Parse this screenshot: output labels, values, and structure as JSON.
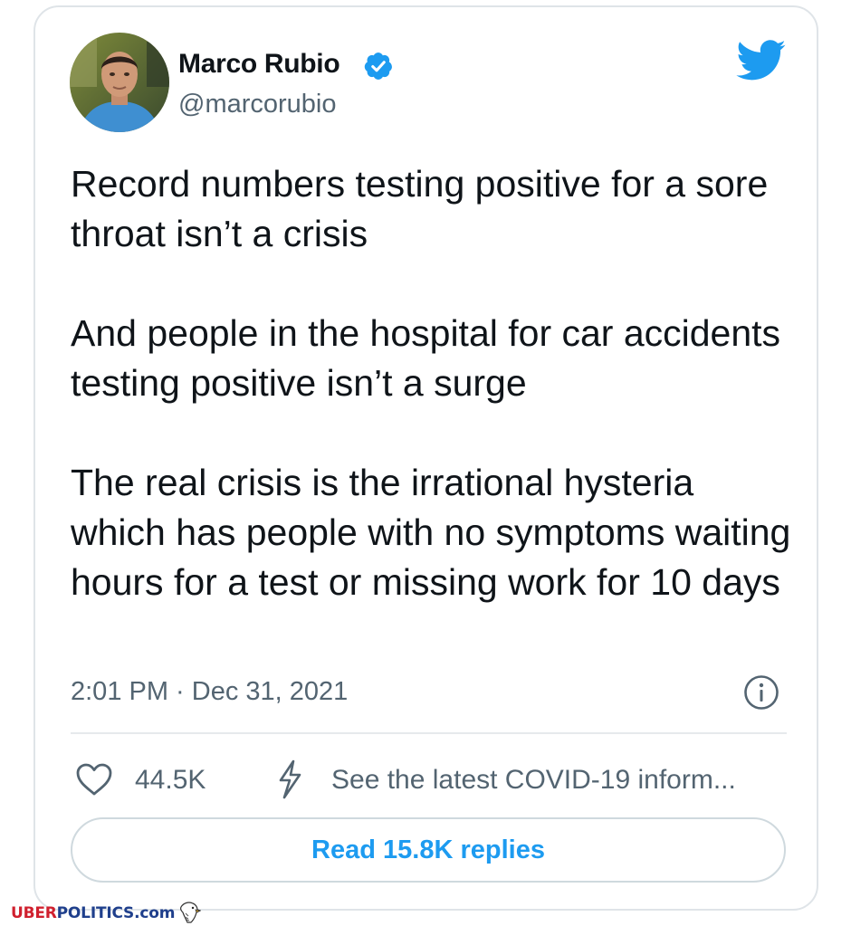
{
  "tweet": {
    "author_name": "Marco Rubio",
    "handle": "@marcorubio",
    "text": "Record numbers testing positive for a sore throat isn’t a crisis\n\nAnd people in the hospital for car accidents testing positive isn’t a surge\n\nThe real crisis is the irrational hysteria which has people with no symptoms waiting hours for a test or missing work for 10 days",
    "timestamp": "2:01 PM · Dec 31, 2021",
    "likes": "44.5K",
    "covid_link": "See the latest COVID-19 inform...",
    "replies_button": "Read 15.8K replies"
  },
  "icons": {
    "verified": "verified-badge-icon",
    "brand": "twitter-bird-icon",
    "info": "info-icon",
    "like": "heart-icon",
    "covid": "lightning-bolt-icon"
  },
  "watermark": {
    "uber": "UBER",
    "politics": "POLITICS.com"
  },
  "colors": {
    "brand_blue": "#1d9bf0",
    "text": "#0f1419",
    "secondary_text": "#536471",
    "border": "#cfd9de",
    "watermark_red": "#d0202e",
    "watermark_blue": "#1f3f8c"
  }
}
